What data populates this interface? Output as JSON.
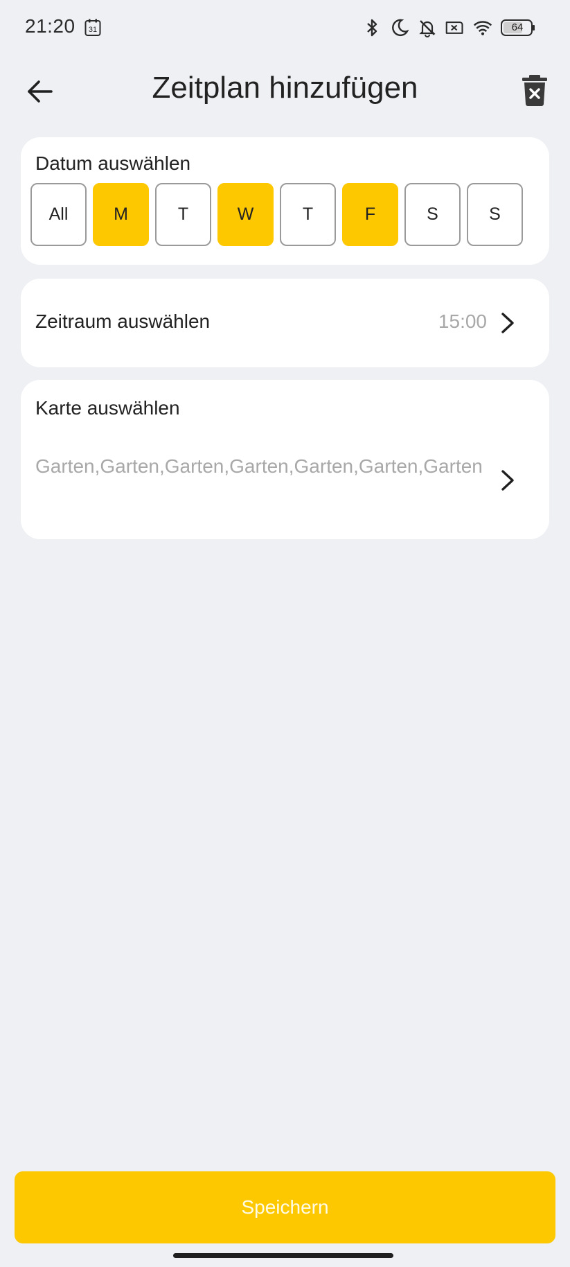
{
  "status_bar": {
    "time": "21:20",
    "calendar_day": "31",
    "battery_level": "64",
    "icons": [
      "bluetooth-icon",
      "do-not-disturb-moon-icon",
      "silent-bell-icon",
      "no-sim-icon",
      "wifi-icon",
      "battery-icon"
    ]
  },
  "header": {
    "title": "Zeitplan hinzufügen",
    "back_icon": "arrow-left-icon",
    "delete_icon": "trash-x-icon"
  },
  "date_section": {
    "title": "Datum auswählen",
    "days": [
      {
        "label": "All",
        "selected": false
      },
      {
        "label": "M",
        "selected": true
      },
      {
        "label": "T",
        "selected": false
      },
      {
        "label": "W",
        "selected": true
      },
      {
        "label": "T",
        "selected": false
      },
      {
        "label": "F",
        "selected": true
      },
      {
        "label": "S",
        "selected": false
      },
      {
        "label": "S",
        "selected": false
      }
    ]
  },
  "time_section": {
    "title": "Zeitraum auswählen",
    "value": "15:00"
  },
  "map_section": {
    "title": "Karte auswählen",
    "value": "Garten,Garten,Garten,Garten,Garten,Garten,Garten"
  },
  "save_label": "Speichern",
  "colors": {
    "accent": "#fdc800",
    "background": "#eef0f4",
    "card": "#ffffff",
    "muted_text": "#a8a8a8"
  }
}
